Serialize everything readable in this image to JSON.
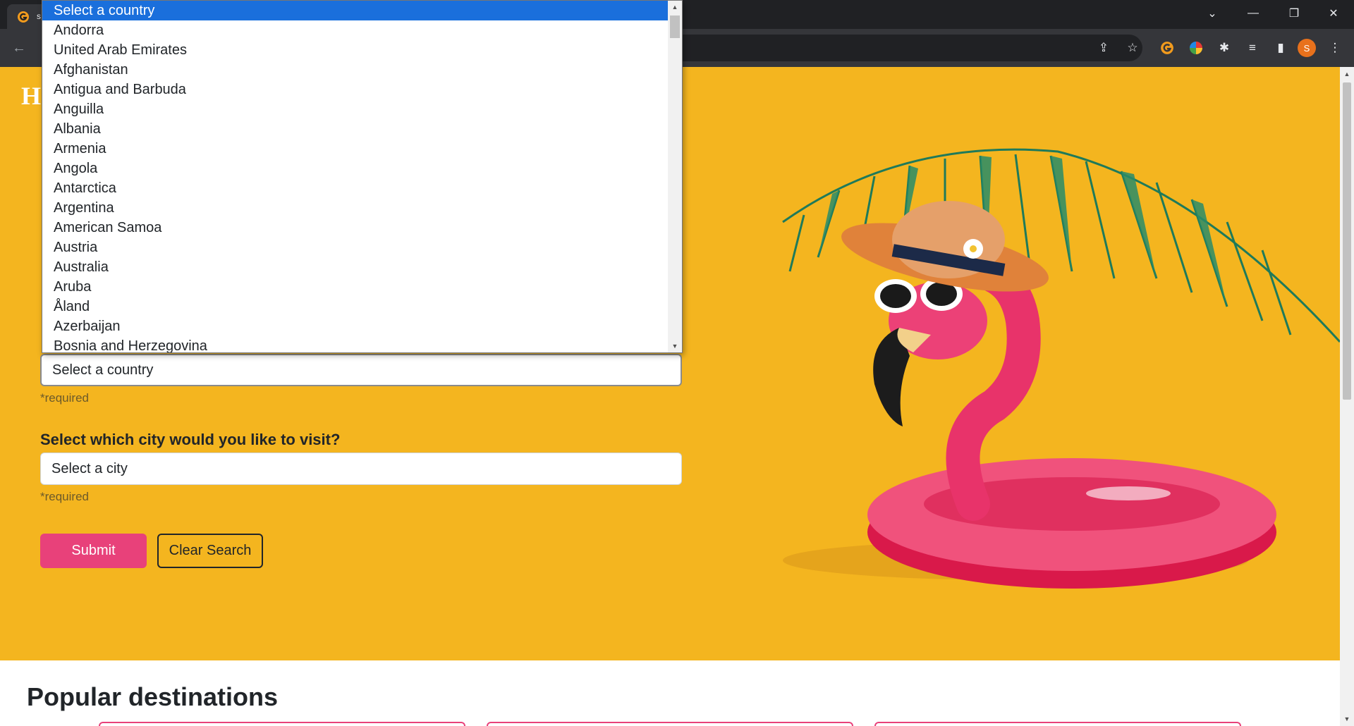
{
  "browser": {
    "tab_title": "s",
    "colors": {
      "titlebar": "#202124",
      "toolbar": "#35363a"
    },
    "window_controls": [
      "chevron-down-icon",
      "minimize-icon",
      "restore-icon",
      "close-icon"
    ],
    "toolbar_icons": [
      "share-icon",
      "star-icon",
      "grammarly-icon",
      "color-wheel-icon",
      "puzzle-icon",
      "media-icon",
      "sidepanel-icon"
    ],
    "profile_initial": "S"
  },
  "page": {
    "brand": "H",
    "country_select": {
      "value": "Select a country",
      "required_note": "*required"
    },
    "city_field": {
      "label": "Select which city would you like to visit?",
      "value": "Select a city",
      "required_note": "*required"
    },
    "buttons": {
      "submit": "Submit",
      "clear": "Clear Search"
    },
    "popular_title": "Popular destinations",
    "colors": {
      "hero_bg": "#f4b51f",
      "accent": "#e8417a"
    }
  },
  "dropdown": {
    "selected_index": 0,
    "options": [
      "Select a country",
      "Andorra",
      "United Arab Emirates",
      "Afghanistan",
      "Antigua and Barbuda",
      "Anguilla",
      "Albania",
      "Armenia",
      "Angola",
      "Antarctica",
      "Argentina",
      "American Samoa",
      "Austria",
      "Australia",
      "Aruba",
      "Åland",
      "Azerbaijan",
      "Bosnia and Herzegovina"
    ]
  }
}
